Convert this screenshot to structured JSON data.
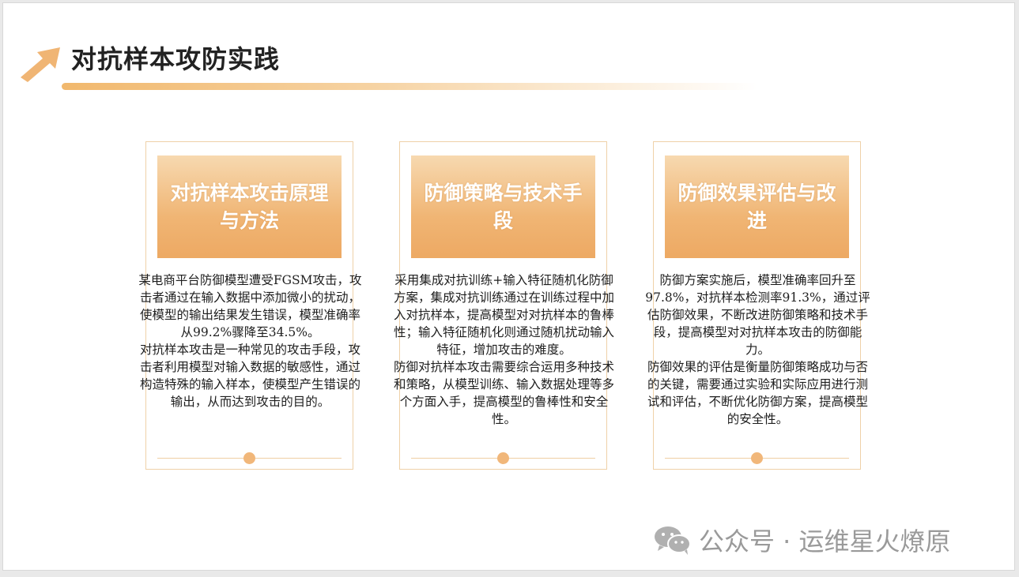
{
  "slide": {
    "title": "对抗样本攻防实践",
    "accent_color": "#f0b574",
    "cards": [
      {
        "heading": "对抗样本攻击原理与方法",
        "paragraphs": [
          "某电商平台防御模型遭受FGSM攻击，攻击者通过在输入数据中添加微小的扰动，使模型的输出结果发生错误，模型准确率从99.2%骤降至34.5%。",
          "对抗样本攻击是一种常见的攻击手段，攻击者利用模型对输入数据的敏感性，通过构造特殊的输入样本，使模型产生错误的输出，从而达到攻击的目的。"
        ]
      },
      {
        "heading": "防御策略与技术手段",
        "paragraphs": [
          "采用集成对抗训练+输入特征随机化防御方案，集成对抗训练通过在训练过程中加入对抗样本，提高模型对对抗样本的鲁棒性；输入特征随机化则通过随机扰动输入特征，增加攻击的难度。",
          "防御对抗样本攻击需要综合运用多种技术和策略，从模型训练、输入数据处理等多个方面入手，提高模型的鲁棒性和安全性。"
        ]
      },
      {
        "heading": "防御效果评估与改进",
        "paragraphs": [
          "防御方案实施后，模型准确率回升至97.8%，对抗样本检测率91.3%，通过评估防御效果，不断改进防御策略和技术手段，提高模型对对抗样本攻击的防御能力。",
          "防御效果的评估是衡量防御策略成功与否的关键，需要通过实验和实际应用进行测试和评估，不断优化防御方案，提高模型的安全性。"
        ]
      }
    ]
  },
  "watermark": {
    "text": "公众号 · 运维星火燎原",
    "icon": "wechat-icon"
  }
}
